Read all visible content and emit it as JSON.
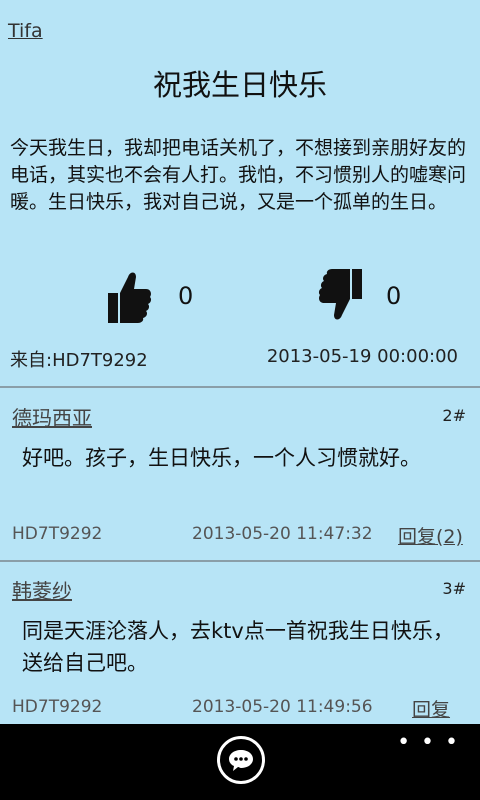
{
  "author": "Tifa",
  "post": {
    "title": "祝我生日快乐",
    "body": "今天我生日，我却把电话关机了，不想接到亲朋好友的电话，其实也不会有人打。我怕，不习惯别人的嘘寒问暖。生日快乐，我对自己说，又是一个孤单的生日。",
    "likes": "0",
    "dislikes": "0",
    "from": "来自:HD7T9292",
    "datetime": "2013-05-19 00:00:00",
    "like_icon": "thumbs-up-icon",
    "dislike_icon": "thumbs-down-icon"
  },
  "replies": [
    {
      "user": "德玛西亚",
      "floor": "2#",
      "text": "好吧。孩子，生日快乐，一个人习惯就好。",
      "code": "HD7T9292",
      "time": "2013-05-20 11:47:32",
      "reply_label": "回复(2)"
    },
    {
      "user": "韩菱纱",
      "floor": "3#",
      "text": "同是天涯沦落人，去ktv点一首祝我生日快乐，送给自己吧。",
      "code": "HD7T9292",
      "time": "2013-05-20 11:49:56",
      "reply_label": "回复"
    }
  ],
  "appbar": {
    "more": "• • •",
    "comment_icon": "comment-icon"
  },
  "colors": {
    "background": "#b7e4f6",
    "appbar": "#000000",
    "divider": "#8a9ea8"
  }
}
